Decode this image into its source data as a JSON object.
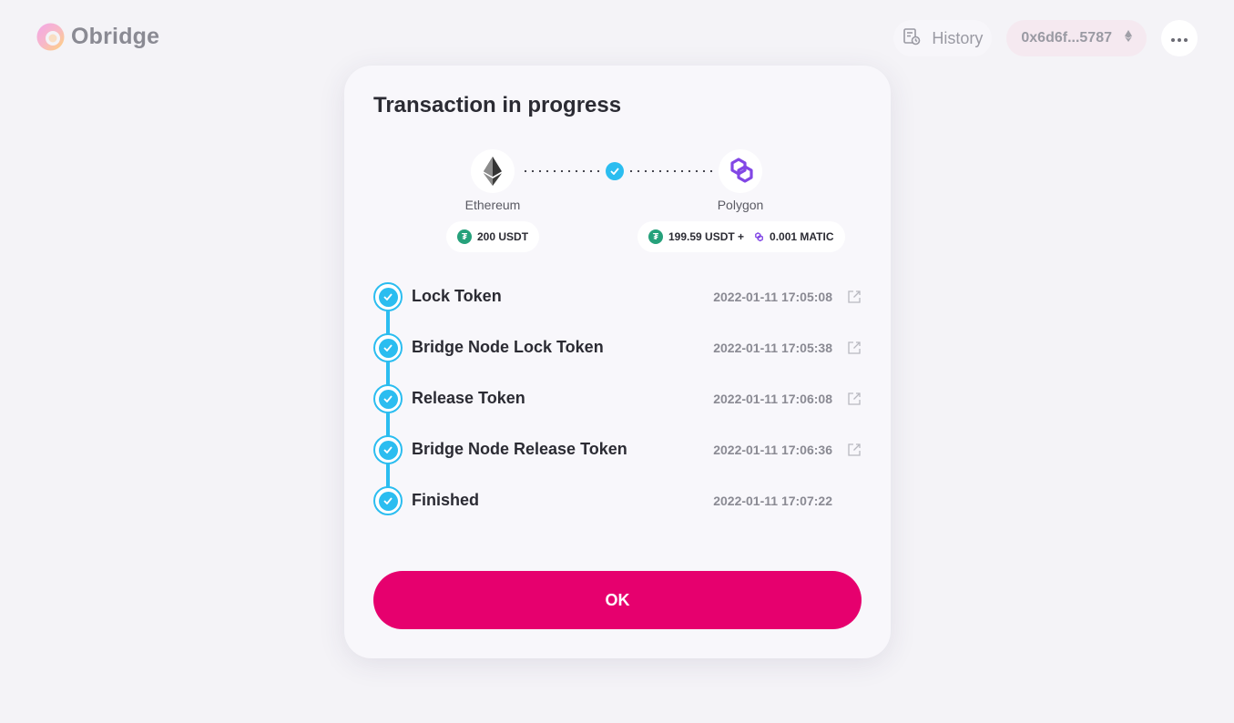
{
  "header": {
    "logo_text": "Obridge",
    "history_label": "History",
    "wallet_address": "0x6d6f...5787"
  },
  "modal": {
    "title": "Transaction in progress",
    "from_chain": {
      "name": "Ethereum",
      "amount": "200 USDT",
      "token_icon": "usdt-icon"
    },
    "to_chain": {
      "name": "Polygon",
      "amount": "199.59 USDT +",
      "extra_amount": "0.001 MATIC",
      "token_icon": "usdt-icon",
      "extra_icon": "matic-icon"
    },
    "steps": [
      {
        "label": "Lock Token",
        "time": "2022-01-11 17:05:08",
        "has_link": true
      },
      {
        "label": "Bridge Node Lock Token",
        "time": "2022-01-11 17:05:38",
        "has_link": true
      },
      {
        "label": "Release Token",
        "time": "2022-01-11 17:06:08",
        "has_link": true
      },
      {
        "label": "Bridge Node Release Token",
        "time": "2022-01-11 17:06:36",
        "has_link": true
      },
      {
        "label": "Finished",
        "time": "2022-01-11 17:07:22",
        "has_link": false
      }
    ],
    "ok_label": "OK"
  },
  "colors": {
    "accent": "#e6006e",
    "progress": "#2bbdf0",
    "background": "#f4f3f7",
    "usdt": "#26a17b",
    "polygon": "#8247e5"
  }
}
